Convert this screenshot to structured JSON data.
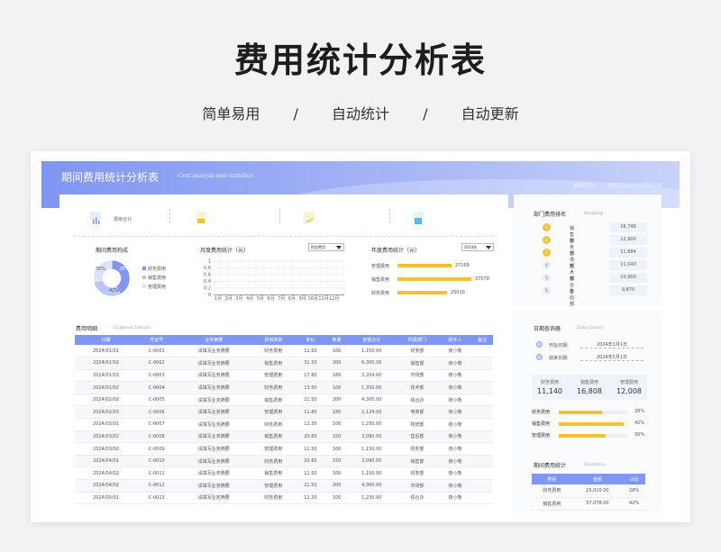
{
  "hero": {
    "title": "费用统计分析表",
    "sub": [
      "简单易用",
      "/",
      "自动统计",
      "/",
      "自动更新"
    ]
  },
  "banner": {
    "title": "期间费用统计分析表",
    "en": "Cost analysis and statistics",
    "editor_label": "编制单位:",
    "company": "熊猫办公软件有限公司"
  },
  "summary": {
    "label": "费用合计",
    "icons": [
      "chart-icon",
      "wallet-icon",
      "trend-icon",
      "calendar-icon"
    ]
  },
  "composition": {
    "title": "期间费用构成",
    "legend": [
      "财务费用",
      "销售费用",
      "管理费用"
    ],
    "labels": [
      "30%",
      "28%",
      "42%"
    ]
  },
  "monthly": {
    "title": "月度费用统计（元）",
    "select": "财务费用",
    "yticks": [
      "1",
      "0.8",
      "0.6",
      "0.4",
      "0.2",
      "0"
    ],
    "months": [
      "1月",
      "2月",
      "3月",
      "4月",
      "5月",
      "6月",
      "7月",
      "8月",
      "9月",
      "10月",
      "11月",
      "12月"
    ]
  },
  "annual": {
    "title": "年度费用统计（元）",
    "select": "2024年",
    "rows": [
      {
        "name": "管理费用",
        "value": "27168",
        "ratio": 0.73
      },
      {
        "name": "销售费用",
        "value": "37078",
        "ratio": 1.0
      },
      {
        "name": "财务费用",
        "value": "25010",
        "ratio": 0.67
      }
    ]
  },
  "detail": {
    "title": "费用明细",
    "en": "Expense Details",
    "headers": [
      "日期",
      "凭证号",
      "业务摘要",
      "费用类别",
      "单价",
      "数量",
      "金额合计",
      "所属部门",
      "经手人",
      "备注"
    ],
    "rows": [
      [
        "2024/01/01",
        "C-0001",
        "请填写业务摘要",
        "财务费用",
        "11.50",
        "100",
        "1,150.00",
        "财务部",
        "夜小熊",
        ""
      ],
      [
        "2024/01/02",
        "C-0002",
        "请填写业务摘要",
        "销售费用",
        "31.50",
        "200",
        "6,300.00",
        "销售部",
        "夜小熊",
        ""
      ],
      [
        "2024/01/03",
        "C-0003",
        "请填写业务摘要",
        "管理费用",
        "17.80",
        "180",
        "3,204.00",
        "市场部",
        "夜小熊",
        ""
      ],
      [
        "2024/01/02",
        "C-0004",
        "请填写业务摘要",
        "财务费用",
        "13.50",
        "100",
        "1,350.00",
        "技术部",
        "夜小熊",
        ""
      ],
      [
        "2024/02/02",
        "C-0005",
        "请填写业务摘要",
        "销售费用",
        "21.50",
        "200",
        "4,300.00",
        "综合办",
        "夜小熊",
        ""
      ],
      [
        "2024/02/03",
        "C-0006",
        "请填写业务摘要",
        "管理费用",
        "11.80",
        "180",
        "2,124.00",
        "电商部",
        "夜小熊",
        ""
      ],
      [
        "2024/03/01",
        "C-0007",
        "请填写业务摘要",
        "财务费用",
        "12.30",
        "100",
        "1,230.00",
        "物流部",
        "夜小熊",
        ""
      ],
      [
        "2024/03/02",
        "C-0008",
        "请填写业务摘要",
        "销售费用",
        "20.60",
        "150",
        "3,090.00",
        "售后部",
        "夜小熊",
        ""
      ],
      [
        "2024/03/02",
        "C-0009",
        "请填写业务摘要",
        "管理费用",
        "11.50",
        "100",
        "1,150.00",
        "财务部",
        "夜小熊",
        ""
      ],
      [
        "2024/04/01",
        "C-0010",
        "请填写业务摘要",
        "财务费用",
        "20.60",
        "150",
        "3,090.00",
        "销售部",
        "夜小熊",
        ""
      ],
      [
        "2024/04/02",
        "C-0011",
        "请填写业务摘要",
        "销售费用",
        "11.50",
        "100",
        "1,150.00",
        "财务部",
        "夜小熊",
        ""
      ],
      [
        "2024/04/02",
        "C-0012",
        "请填写业务摘要",
        "管理费用",
        "21.50",
        "200",
        "4,300.00",
        "市场部",
        "夜小熊",
        ""
      ],
      [
        "2024/05/01",
        "C-0013",
        "请填写业务摘要",
        "财务费用",
        "12.30",
        "100",
        "1,230.00",
        "综合办",
        "夜小熊",
        ""
      ]
    ]
  },
  "ranking": {
    "title": "部门费用排名",
    "en": "Ranking",
    "rows": [
      {
        "n": "1",
        "name": "销售部",
        "value": "16,748"
      },
      {
        "n": "2",
        "name": "财务部",
        "value": "12,900"
      },
      {
        "n": "3",
        "name": "市场部",
        "value": "11,684"
      },
      {
        "n": "4",
        "name": "技术部",
        "value": "11,040"
      },
      {
        "n": "5",
        "name": "综合办",
        "value": "10,900"
      },
      {
        "n": "6",
        "name": "售后部",
        "value": "9,870"
      }
    ]
  },
  "date_query": {
    "title": "日期查询器",
    "en": "Date Query",
    "start_label": "开始日期:",
    "start": "2024年1月1日",
    "end_label": "结束日期:",
    "end": "2024年5月1日"
  },
  "totals": {
    "labels": [
      "财务费用",
      "销售费用",
      "管理费用"
    ],
    "values": [
      "11,140",
      "16,808",
      "12,008"
    ]
  },
  "share_bars": [
    {
      "name": "财务费用",
      "pct": "28%",
      "ratio": 0.28
    },
    {
      "name": "销售费用",
      "pct": "42%",
      "ratio": 0.42
    },
    {
      "name": "管理费用",
      "pct": "30%",
      "ratio": 0.3
    }
  ],
  "stats": {
    "title": "期间费用统计",
    "en": "Statistics",
    "headers": [
      "类别",
      "金额",
      "占比"
    ],
    "rows": [
      [
        "财务费用",
        "25,010.00",
        "28%"
      ],
      [
        "销售费用",
        "37,078.00",
        "42%"
      ]
    ]
  },
  "chart_data": {
    "type": "pie",
    "categories": [
      "财务费用",
      "销售费用",
      "管理费用"
    ],
    "values": [
      28,
      42,
      30
    ]
  },
  "colors": {
    "accent": "#7f96f2",
    "gold": "#f1c232"
  }
}
